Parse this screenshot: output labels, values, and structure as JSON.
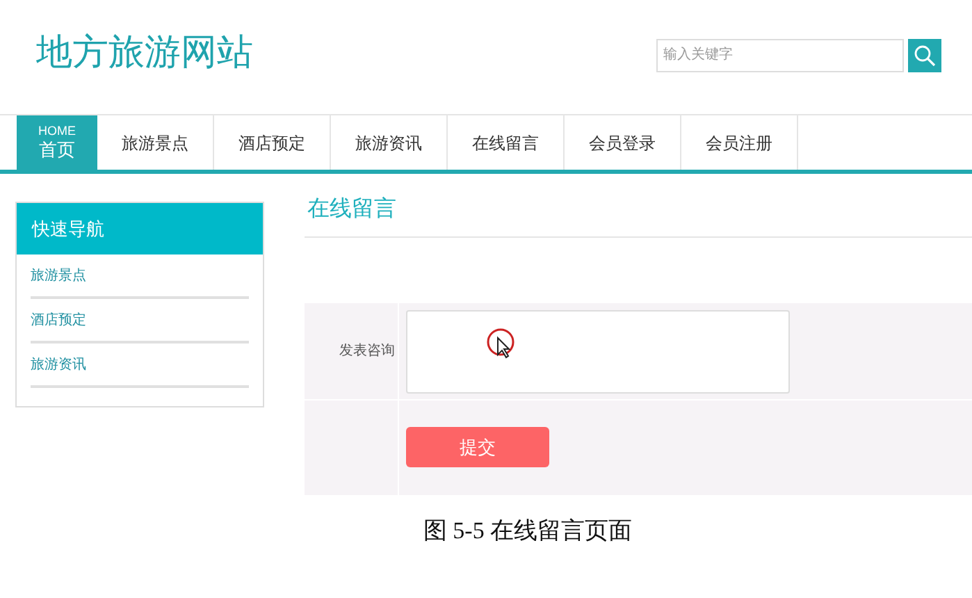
{
  "site_title": "地方旅游网站",
  "search": {
    "placeholder": "输入关键字"
  },
  "nav": [
    {
      "label": "首页",
      "sublabel": "HOME",
      "selected": true
    },
    {
      "label": "旅游景点",
      "selected": false
    },
    {
      "label": "酒店预定",
      "selected": false
    },
    {
      "label": "旅游资讯",
      "selected": false
    },
    {
      "label": "在线留言",
      "selected": false
    },
    {
      "label": "会员登录",
      "selected": false
    },
    {
      "label": "会员注册",
      "selected": false
    }
  ],
  "sidebar": {
    "title": "快速导航",
    "items": [
      "旅游景点",
      "酒店预定",
      "旅游资讯"
    ]
  },
  "content": {
    "heading": "在线留言",
    "field_label": "发表咨询",
    "submit": "提交"
  },
  "caption": "图 5-5 在线留言页面"
}
